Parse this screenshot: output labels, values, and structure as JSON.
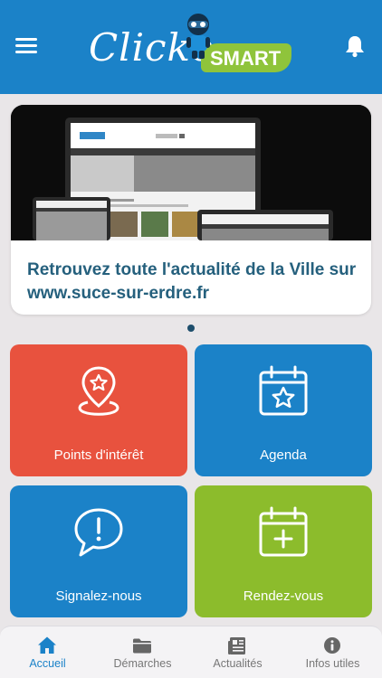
{
  "header": {
    "logo_script": "Clicko",
    "logo_badge": "SMART",
    "menu_icon": "hamburger-menu-icon",
    "notification_icon": "bell-icon",
    "color": "#1b82c8"
  },
  "carousel": {
    "card_title": "Retrouvez toute l'actualité de la Ville sur www.suce-sur-erdre.fr",
    "page_indicator": "1 of 1"
  },
  "tiles": [
    {
      "label": "Points d'intérêt",
      "icon": "map-pin-star-icon",
      "color": "#e8523e"
    },
    {
      "label": "Agenda",
      "icon": "calendar-star-icon",
      "color": "#1b82c8"
    },
    {
      "label": "Signalez-nous",
      "icon": "speech-bubble-exclamation-icon",
      "color": "#1b82c8"
    },
    {
      "label": "Rendez-vous",
      "icon": "calendar-plus-icon",
      "color": "#8cbc2c"
    }
  ],
  "tabbar": {
    "items": [
      {
        "label": "Accueil",
        "icon": "home-icon",
        "active": true
      },
      {
        "label": "Démarches",
        "icon": "folder-icon",
        "active": false
      },
      {
        "label": "Actualités",
        "icon": "newspaper-icon",
        "active": false
      },
      {
        "label": "Infos utiles",
        "icon": "info-circle-icon",
        "active": false
      }
    ],
    "active_color": "#1b82c8"
  }
}
